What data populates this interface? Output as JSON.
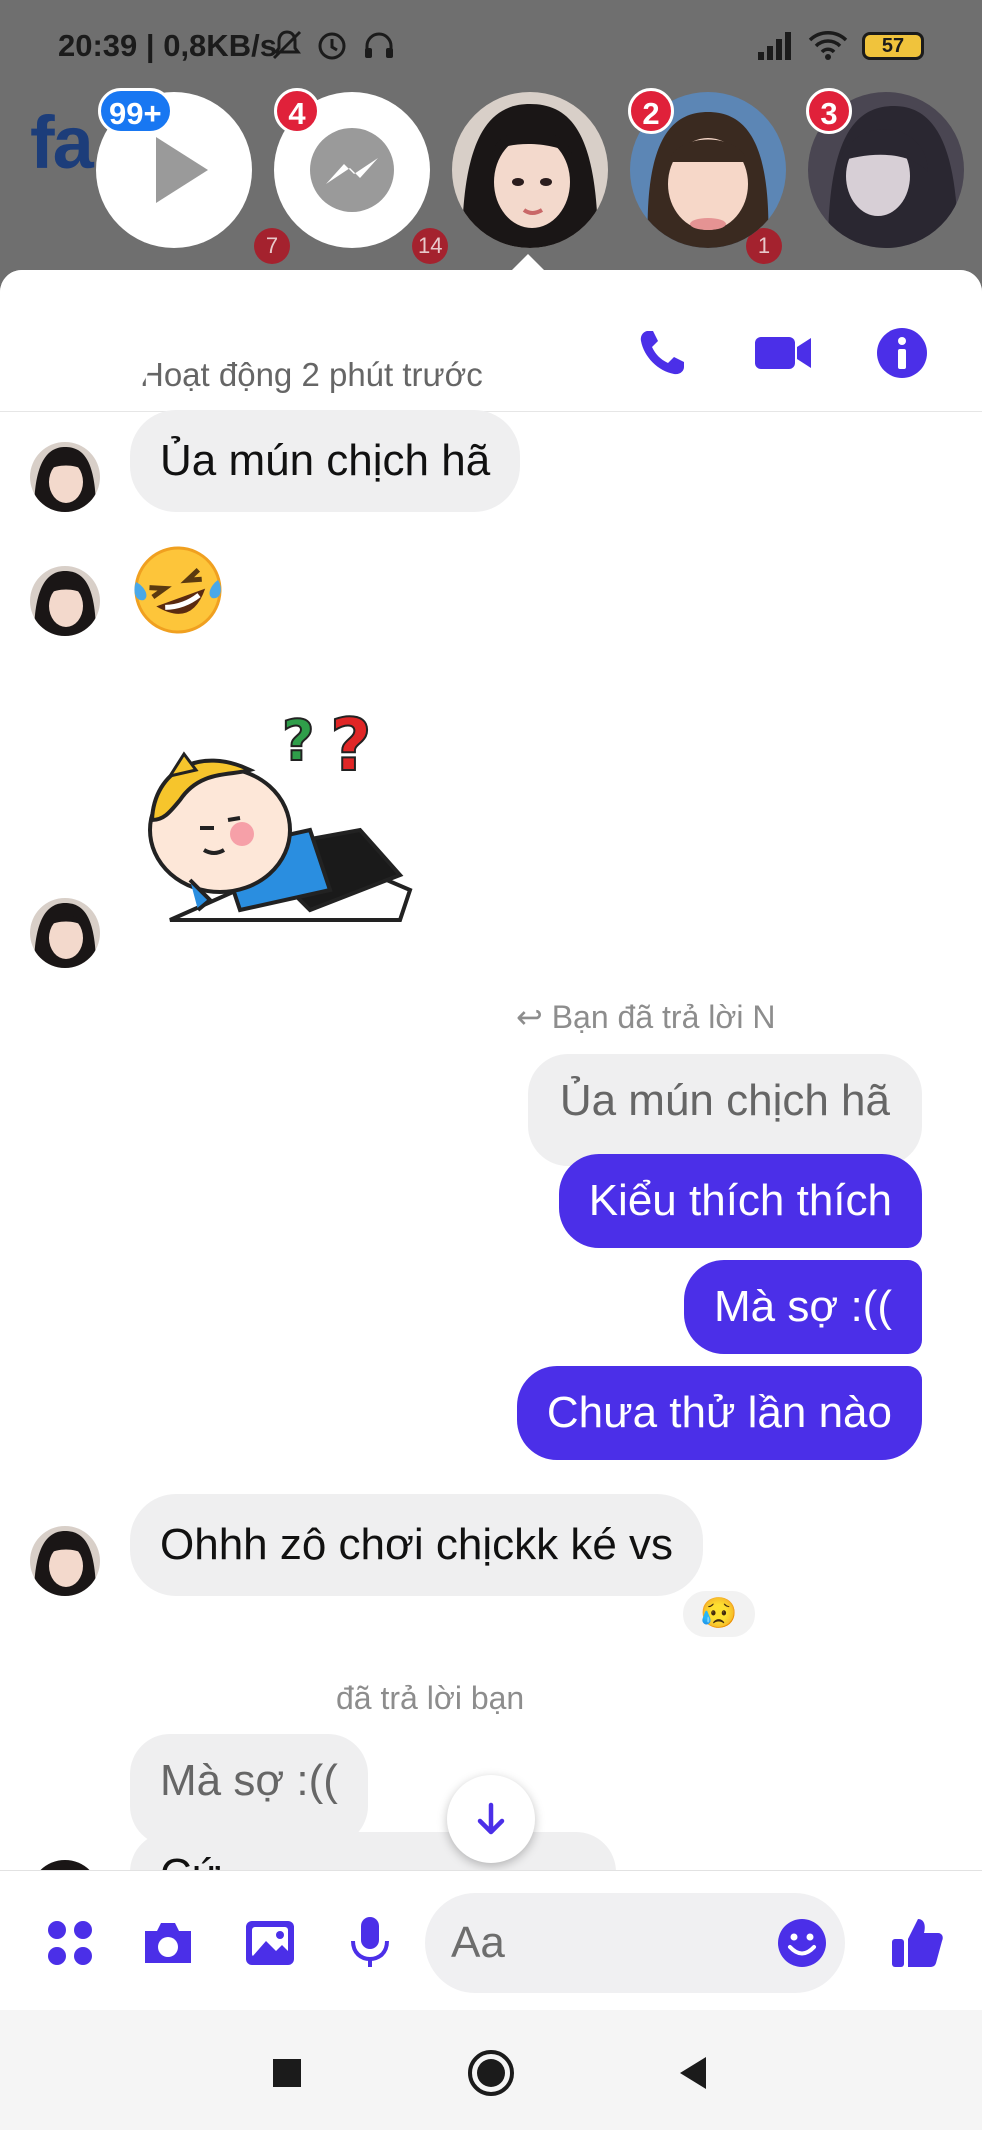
{
  "status_bar": {
    "time": "20:39",
    "speed": "| 0,8KB/s",
    "battery": "57"
  },
  "backdrop": {
    "logo_text": "fa"
  },
  "chat_heads": [
    {
      "name": "video-head",
      "badge": "99+"
    },
    {
      "name": "messenger-head",
      "badge": "4"
    },
    {
      "name": "contact-head-1",
      "badge": ""
    },
    {
      "name": "contact-head-2",
      "badge": "2"
    },
    {
      "name": "contact-head-3",
      "badge": "3"
    }
  ],
  "behind_badges": [
    "7",
    "14",
    "1"
  ],
  "header": {
    "status": "Hoạt động 2 phút trước"
  },
  "messages": {
    "in_1": "Ủa mún chịch hã",
    "in_2_emoji": "🤣",
    "reply_note_1": "Bạn đã trả lời N",
    "quoted_1": "Ủa mún chịch hã",
    "out_1": "Kiểu thích thích",
    "out_2": "Mà sợ :((",
    "out_3": "Chưa thử lần nào",
    "in_3": "Ohhh zô chơi chịckk ké vs",
    "reaction": "😥",
    "reply_note_2": "đã trả lời bạn",
    "quoted_2": "Mà sợ :((",
    "in_4_partial": "Cứ ..."
  },
  "composer": {
    "placeholder": "Aa"
  },
  "colors": {
    "accent": "#4b2fe8",
    "badge": "#e0213a"
  }
}
